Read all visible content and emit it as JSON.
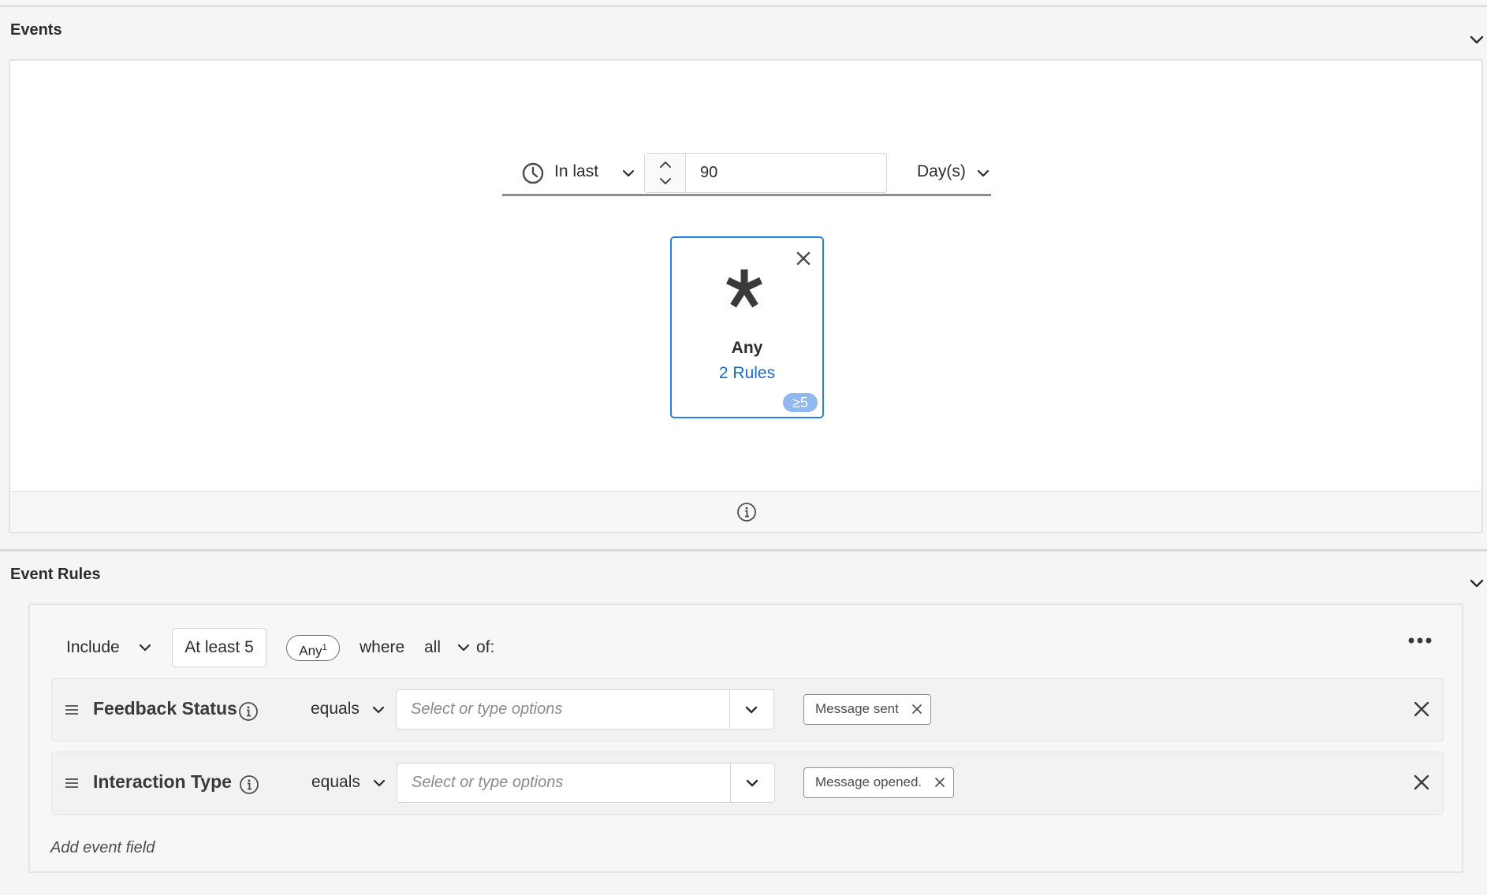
{
  "events": {
    "title": "Events",
    "time": {
      "mode_label": "In last",
      "value": "90",
      "unit_label": "Day(s)"
    },
    "card": {
      "label": "Any",
      "rules_link": "2 Rules",
      "badge": "≥5"
    }
  },
  "event_rules": {
    "title": "Event Rules",
    "header": {
      "include_label": "Include",
      "at_least_label": "At least 5",
      "any_pill_label": "Any",
      "any_pill_count": "1",
      "where_label": "where",
      "all_label": "all",
      "of_label": "of:"
    },
    "rows": [
      {
        "field": "Feedback Status",
        "operator": "equals",
        "placeholder": "Select or type options",
        "tag": "Message sent"
      },
      {
        "field": "Interaction Type",
        "operator": "equals",
        "placeholder": "Select or type options",
        "tag": "Message opened."
      }
    ],
    "add_field_label": "Add event field"
  },
  "colors": {
    "accent": "#2680eb",
    "link": "#1b6ac9",
    "badge": "#8fb9ef"
  }
}
